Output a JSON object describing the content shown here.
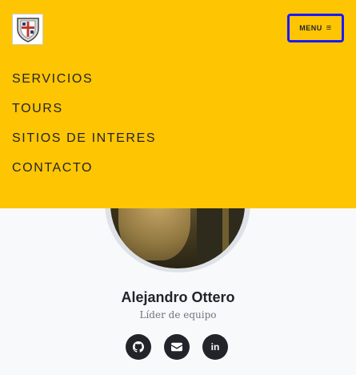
{
  "navbar": {
    "menu_label": "MENU",
    "menu_icon": "bars-icon",
    "links": [
      {
        "label": "SERVICIOS"
      },
      {
        "label": "TOURS"
      },
      {
        "label": "SITIOS DE INTERES"
      },
      {
        "label": "CONTACTO"
      }
    ],
    "colors": {
      "background": "#fec503",
      "focus_border": "#1a1aff"
    }
  },
  "team": {
    "member": {
      "name": "Alejandro Ottero",
      "role": "Líder de equipo"
    },
    "socials": [
      {
        "icon": "github-icon"
      },
      {
        "icon": "envelope-icon"
      },
      {
        "icon": "linkedin-icon",
        "text": "in"
      }
    ]
  }
}
